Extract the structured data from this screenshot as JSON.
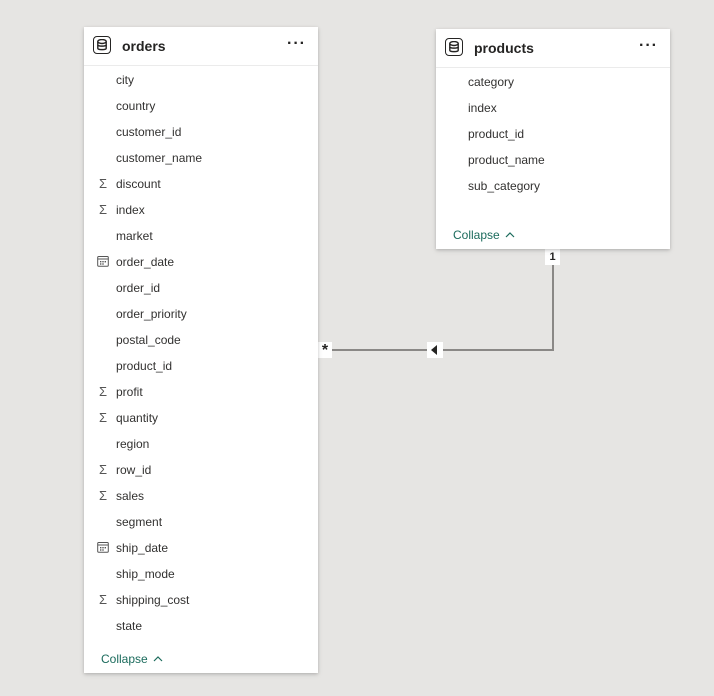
{
  "orders": {
    "title": "orders",
    "more_label": "···",
    "fields": [
      {
        "name": "city",
        "icon": ""
      },
      {
        "name": "country",
        "icon": ""
      },
      {
        "name": "customer_id",
        "icon": ""
      },
      {
        "name": "customer_name",
        "icon": ""
      },
      {
        "name": "discount",
        "icon": "sigma-icon"
      },
      {
        "name": "index",
        "icon": "sigma-icon"
      },
      {
        "name": "market",
        "icon": ""
      },
      {
        "name": "order_date",
        "icon": "calendar-icon"
      },
      {
        "name": "order_id",
        "icon": ""
      },
      {
        "name": "order_priority",
        "icon": ""
      },
      {
        "name": "postal_code",
        "icon": ""
      },
      {
        "name": "product_id",
        "icon": ""
      },
      {
        "name": "profit",
        "icon": "sigma-icon"
      },
      {
        "name": "quantity",
        "icon": "sigma-icon"
      },
      {
        "name": "region",
        "icon": ""
      },
      {
        "name": "row_id",
        "icon": "sigma-icon"
      },
      {
        "name": "sales",
        "icon": "sigma-icon"
      },
      {
        "name": "segment",
        "icon": ""
      },
      {
        "name": "ship_date",
        "icon": "calendar-icon"
      },
      {
        "name": "ship_mode",
        "icon": ""
      },
      {
        "name": "shipping_cost",
        "icon": "sigma-icon"
      },
      {
        "name": "state",
        "icon": ""
      }
    ],
    "collapse_label": "Collapse"
  },
  "products": {
    "title": "products",
    "more_label": "···",
    "fields": [
      {
        "name": "category",
        "icon": ""
      },
      {
        "name": "index",
        "icon": ""
      },
      {
        "name": "product_id",
        "icon": ""
      },
      {
        "name": "product_name",
        "icon": ""
      },
      {
        "name": "sub_category",
        "icon": ""
      }
    ],
    "collapse_label": "Collapse"
  },
  "relationship": {
    "many_label": "*",
    "one_label": "1"
  },
  "colors": {
    "canvas": "#e6e5e3",
    "card": "#ffffff",
    "link": "#1b6b5c",
    "line": "#8a8886"
  }
}
